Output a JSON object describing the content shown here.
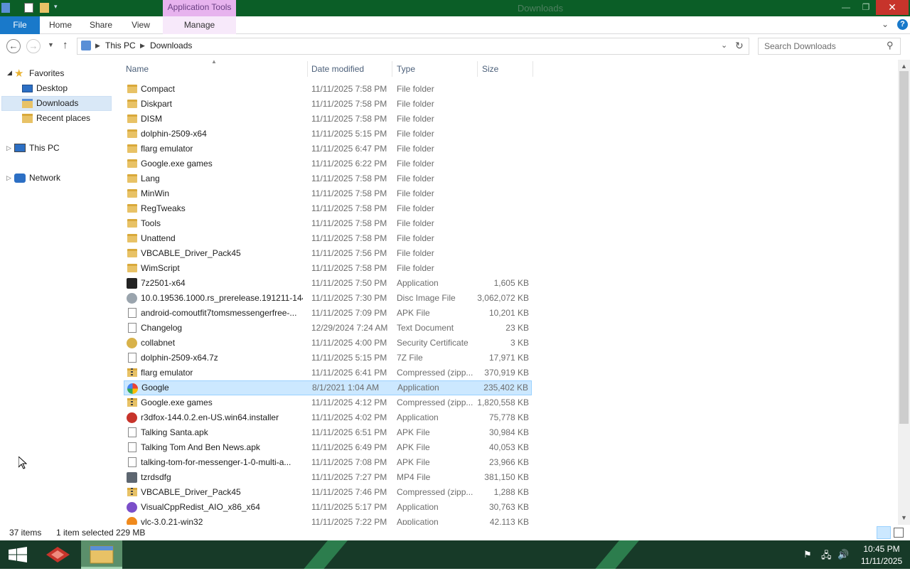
{
  "window": {
    "title": "Downloads",
    "context_tab": "Application Tools",
    "minimize_glyph": "—",
    "maximize_glyph": "❐",
    "close_glyph": "✕"
  },
  "ribbon": {
    "file": "File",
    "home": "Home",
    "share": "Share",
    "view": "View",
    "manage": "Manage"
  },
  "address": {
    "crumbs": [
      "This PC",
      "Downloads"
    ],
    "search_placeholder": "Search Downloads"
  },
  "nav": {
    "favorites": "Favorites",
    "desktop": "Desktop",
    "downloads": "Downloads",
    "recent": "Recent places",
    "this_pc": "This PC",
    "network": "Network"
  },
  "columns": {
    "name": "Name",
    "date": "Date modified",
    "type": "Type",
    "size": "Size"
  },
  "files": [
    {
      "name": "Compact",
      "date": "11/11/2025 7:58 PM",
      "type": "File folder",
      "size": "",
      "icon": "folder-icon"
    },
    {
      "name": "Diskpart",
      "date": "11/11/2025 7:58 PM",
      "type": "File folder",
      "size": "",
      "icon": "folder-icon"
    },
    {
      "name": "DISM",
      "date": "11/11/2025 7:58 PM",
      "type": "File folder",
      "size": "",
      "icon": "folder-icon"
    },
    {
      "name": "dolphin-2509-x64",
      "date": "11/11/2025 5:15 PM",
      "type": "File folder",
      "size": "",
      "icon": "folder-icon"
    },
    {
      "name": "flarg emulator",
      "date": "11/11/2025 6:47 PM",
      "type": "File folder",
      "size": "",
      "icon": "folder-icon"
    },
    {
      "name": "Google.exe games",
      "date": "11/11/2025 6:22 PM",
      "type": "File folder",
      "size": "",
      "icon": "folder-icon"
    },
    {
      "name": "Lang",
      "date": "11/11/2025 7:58 PM",
      "type": "File folder",
      "size": "",
      "icon": "folder-icon"
    },
    {
      "name": "MinWin",
      "date": "11/11/2025 7:58 PM",
      "type": "File folder",
      "size": "",
      "icon": "folder-icon"
    },
    {
      "name": "RegTweaks",
      "date": "11/11/2025 7:58 PM",
      "type": "File folder",
      "size": "",
      "icon": "folder-icon"
    },
    {
      "name": "Tools",
      "date": "11/11/2025 7:58 PM",
      "type": "File folder",
      "size": "",
      "icon": "folder-icon"
    },
    {
      "name": "Unattend",
      "date": "11/11/2025 7:58 PM",
      "type": "File folder",
      "size": "",
      "icon": "folder-icon"
    },
    {
      "name": "VBCABLE_Driver_Pack45",
      "date": "11/11/2025 7:56 PM",
      "type": "File folder",
      "size": "",
      "icon": "folder-icon"
    },
    {
      "name": "WimScript",
      "date": "11/11/2025 7:58 PM",
      "type": "File folder",
      "size": "",
      "icon": "folder-icon"
    },
    {
      "name": "7z2501-x64",
      "date": "11/11/2025 7:50 PM",
      "type": "Application",
      "size": "1,605 KB",
      "icon": "7zip-icon"
    },
    {
      "name": "10.0.19536.1000.rs_prerelease.191211-144...",
      "date": "11/11/2025 7:30 PM",
      "type": "Disc Image File",
      "size": "3,062,072 KB",
      "icon": "disc-image-icon"
    },
    {
      "name": "android-comoutfit7tomsmessengerfree-...",
      "date": "11/11/2025 7:09 PM",
      "type": "APK File",
      "size": "10,201 KB",
      "icon": "file-icon"
    },
    {
      "name": "Changelog",
      "date": "12/29/2024 7:24 AM",
      "type": "Text Document",
      "size": "23 KB",
      "icon": "text-file-icon"
    },
    {
      "name": "collabnet",
      "date": "11/11/2025 4:00 PM",
      "type": "Security Certificate",
      "size": "3 KB",
      "icon": "certificate-icon"
    },
    {
      "name": "dolphin-2509-x64.7z",
      "date": "11/11/2025 5:15 PM",
      "type": "7Z File",
      "size": "17,971 KB",
      "icon": "file-icon"
    },
    {
      "name": "flarg emulator",
      "date": "11/11/2025 6:41 PM",
      "type": "Compressed (zipp...",
      "size": "370,919 KB",
      "icon": "zip-folder-icon"
    },
    {
      "name": "Google",
      "date": "8/1/2021 1:04 AM",
      "type": "Application",
      "size": "235,402 KB",
      "icon": "google-icon",
      "selected": true
    },
    {
      "name": "Google.exe games",
      "date": "11/11/2025 4:12 PM",
      "type": "Compressed (zipp...",
      "size": "1,820,558 KB",
      "icon": "zip-folder-icon"
    },
    {
      "name": "r3dfox-144.0.2.en-US.win64.installer",
      "date": "11/11/2025 4:02 PM",
      "type": "Application",
      "size": "75,778 KB",
      "icon": "r3dfox-icon"
    },
    {
      "name": "Talking Santa.apk",
      "date": "11/11/2025 6:51 PM",
      "type": "APK File",
      "size": "30,984 KB",
      "icon": "file-icon"
    },
    {
      "name": "Talking Tom And Ben News.apk",
      "date": "11/11/2025 6:49 PM",
      "type": "APK File",
      "size": "40,053 KB",
      "icon": "file-icon"
    },
    {
      "name": "talking-tom-for-messenger-1-0-multi-a...",
      "date": "11/11/2025 7:08 PM",
      "type": "APK File",
      "size": "23,966 KB",
      "icon": "file-icon"
    },
    {
      "name": "tzrdsdfg",
      "date": "11/11/2025 7:27 PM",
      "type": "MP4 File",
      "size": "381,150 KB",
      "icon": "video-file-icon"
    },
    {
      "name": "VBCABLE_Driver_Pack45",
      "date": "11/11/2025 7:46 PM",
      "type": "Compressed (zipp...",
      "size": "1,288 KB",
      "icon": "zip-folder-icon"
    },
    {
      "name": "VisualCppRedist_AIO_x86_x64",
      "date": "11/11/2025 5:17 PM",
      "type": "Application",
      "size": "30,763 KB",
      "icon": "installer-icon"
    },
    {
      "name": "vlc-3.0.21-win32",
      "date": "11/11/2025 7:22 PM",
      "type": "Application",
      "size": "42,113 KB",
      "icon": "vlc-icon"
    }
  ],
  "status": {
    "count": "37 items",
    "selection": "1 item selected  229 MB"
  },
  "taskbar": {
    "time": "10:45 PM",
    "date": "11/11/2025"
  },
  "colors": {
    "titlebar": "#0b5e27",
    "accent": "#1979ca",
    "selection": "#cce8ff",
    "context_tab": "#e7b3ee"
  }
}
